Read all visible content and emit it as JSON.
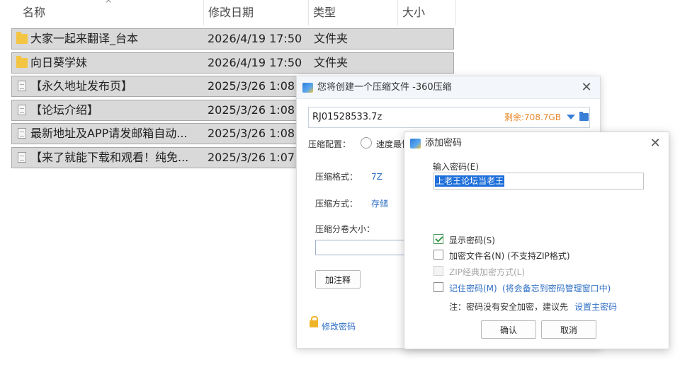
{
  "explorer": {
    "columns": {
      "name": "名称",
      "date": "修改日期",
      "type": "类型",
      "size": "大小"
    },
    "rows": [
      {
        "name": "大家一起来翻译_台本",
        "date": "2026/4/19 17:50",
        "type": "文件夹"
      },
      {
        "name": "向日葵学妹",
        "date": "2026/4/19 17:50",
        "type": "文件夹"
      },
      {
        "name": "【永久地址发布页】",
        "date": "2025/3/26 1:08",
        "type": ""
      },
      {
        "name": "【论坛介绍】",
        "date": "2025/3/26 1:08",
        "type": ""
      },
      {
        "name": "最新地址及APP请发邮箱自动...",
        "date": "2025/3/26 1:08",
        "type": ""
      },
      {
        "name": "【来了就能下载和观看！纯免...",
        "date": "2025/3/26 1:07",
        "type": ""
      }
    ]
  },
  "compress_dialog": {
    "title": "您将创建一个压缩文件 -360压缩",
    "path_value": "RJ01528533.7z",
    "free_space": "剩余:708.7GB",
    "config_label": "压缩配置：",
    "config_option": "速度最快",
    "format_label": "压缩格式：",
    "format_value": "7Z",
    "method_label": "压缩方式：",
    "method_value": "存储",
    "split_label": "压缩分卷大小：",
    "comment_button": "加注释",
    "change_password_link": "修改密码",
    "close_glyph": "✕"
  },
  "password_dialog": {
    "title": "添加密码",
    "input_label": "输入密码(E)",
    "password_value": "上老王论坛当老王",
    "show_password": {
      "label": "显示密码(S)",
      "checked": true
    },
    "encrypt_filenames": {
      "label": "加密文件名(N) (不支持ZIP格式)",
      "checked": false
    },
    "zip_classic": {
      "label": "ZIP经典加密方式(L)",
      "checked": false,
      "disabled": true
    },
    "remember_password": {
      "label": "记住密码(M)",
      "note": "(将会备忘到密码管理窗口中)",
      "checked": false
    },
    "note_text": "注：密码没有安全加密，建议先",
    "note_link": "设置主密码",
    "ok_button": "确认",
    "cancel_button": "取消",
    "close_glyph": "✕"
  },
  "colors": {
    "selection_blue": "#1e6fd9",
    "link_blue": "#2f6fc4",
    "free_space_orange": "#e8892b",
    "row_selected_gray": "#d9d9d9",
    "folder_yellow": "#f4c542"
  },
  "icons": [
    "folder-icon",
    "file-icon",
    "app-360-icon",
    "close-icon",
    "dropdown-arrow-icon",
    "browse-folder-icon",
    "lock-icon",
    "checkbox-check-icon",
    "sort-ascending-icon"
  ]
}
